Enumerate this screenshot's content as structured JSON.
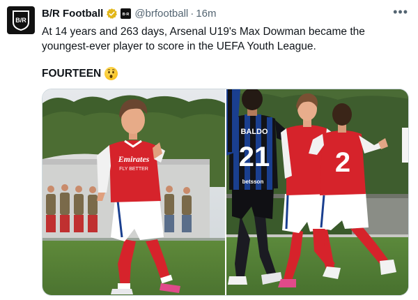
{
  "tweet": {
    "display_name": "B/R Football",
    "handle": "@brfootball",
    "separator": "·",
    "time": "16m",
    "more_label": "•••",
    "avatar_text": "B/R",
    "affiliate_text": "B·R",
    "text": "At 14 years and 263 days, Arsenal U19's Max Dowman became the youngest-ever player to score in the UEFA Youth League.",
    "emphasis": "FOURTEEN",
    "emoji": "astonished-face"
  },
  "media": {
    "photo1": {
      "shirt_sponsor_line1": "Emirates",
      "shirt_sponsor_line2": "FLY BETTER"
    },
    "photo2": {
      "player_name": "BALDO",
      "player_number": "21",
      "sleeve_number": "2",
      "shorts_sponsor": "betsson"
    }
  },
  "colors": {
    "arsenal_red": "#d6232b",
    "inter_blue": "#1a3f8f",
    "verified_gold": "#e2b719",
    "text_secondary": "#536471"
  }
}
